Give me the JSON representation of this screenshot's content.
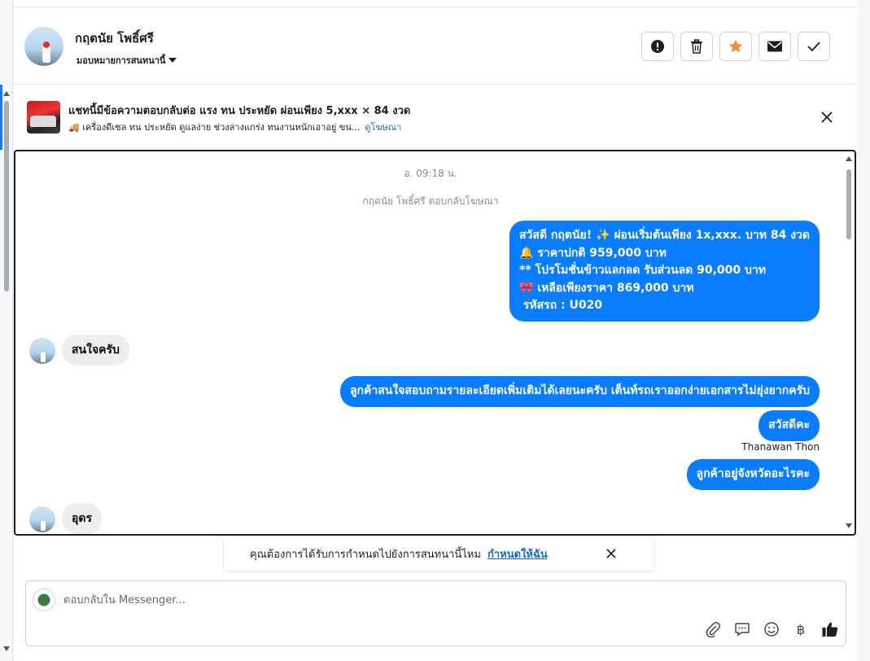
{
  "header": {
    "contact_name": "กฤตนัย โพธิ์ศรี",
    "assign_label": "มอบหมายการสนทนานี้",
    "actions": [
      {
        "icon": "exclamation-icon"
      },
      {
        "icon": "trash-icon"
      },
      {
        "icon": "star-icon"
      },
      {
        "icon": "envelope-icon"
      },
      {
        "icon": "check-icon"
      }
    ],
    "star_color": "#f7923b"
  },
  "ad": {
    "title": "แชทนี้มีข้อความตอบกลับต่อ แรง ทน ประหยัด ผ่อนเพียง 5,xxx × 84 งวด",
    "subtitle": "🚚 เครื่องดีเซล ทน ประหยัด ดูแลง่าย ช่วงล่างแกร่ง ทนงานหนักเอาอยู่ ขน...",
    "link": "ดูโฆษณา"
  },
  "chat": {
    "timestamp": "อ. 09:18 น.",
    "reply_note": "กฤตนัย โพธิ์ศรี ตอบกลับโฆษณา",
    "outgoing_1": {
      "line1": "สวัสดี กฤตนัย! ✨  ผ่อนเริ่มต้นเพียง 1x,xxx. บาท 84 งวด",
      "line2": "🔔 ราคาปกติ 959,000 บาท",
      "line3": "** โปรโมชั่นข้าวแลกลด รับส่วนลด 90,000 บาท",
      "line4": "🎀  เหลือเพียงราคา 869,000 บาท",
      "line5": " รหัสรถ : U020"
    },
    "incoming_1": "สนใจครับ",
    "outgoing_2": "ลูกค้าสนใจสอบถามรายละเอียดเพิ่มเติมได้เลยนะครับ เต็นท์รถเราออกง่ายเอกสารไม่ยุ่งยากครับ",
    "outgoing_3": "สวัสดีคะ",
    "sender": "Thanawan Thon",
    "outgoing_4": "ลูกค้าอยู่จังหวัดอะไรคะ",
    "incoming_2": "อุดร",
    "bubble_color": "#0a7cff"
  },
  "reminder": {
    "text": "คุณต้องการได้รับการกำหนดไปยังการสนทนานี้ไหม",
    "link": "กำหนดให้ฉัน"
  },
  "composer": {
    "placeholder": "ตอบกลับใน Messenger...",
    "currency_symbol": "฿",
    "tools": [
      "paperclip-icon",
      "saved-reply-icon",
      "emoji-icon",
      "baht-icon",
      "thumbs-up-icon"
    ]
  }
}
